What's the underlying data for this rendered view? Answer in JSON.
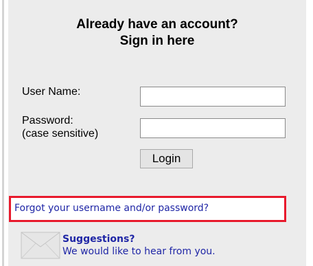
{
  "signin": {
    "heading_line1": "Already have an account?",
    "heading_line2": "Sign in here",
    "username_label": "User Name:",
    "username_value": "",
    "password_label_line1": "Password:",
    "password_label_line2": "(case sensitive)",
    "password_value": "",
    "login_label": "Login"
  },
  "links": {
    "forgot": "Forgot your username and/or password?",
    "suggestions_title": "Suggestions?",
    "suggestions_text": "We would like to hear from you."
  },
  "icons": {
    "envelope": "envelope-icon"
  },
  "colors": {
    "panel_bg": "#ececec",
    "link": "#1f26a6",
    "highlight_border": "#e8192c"
  }
}
